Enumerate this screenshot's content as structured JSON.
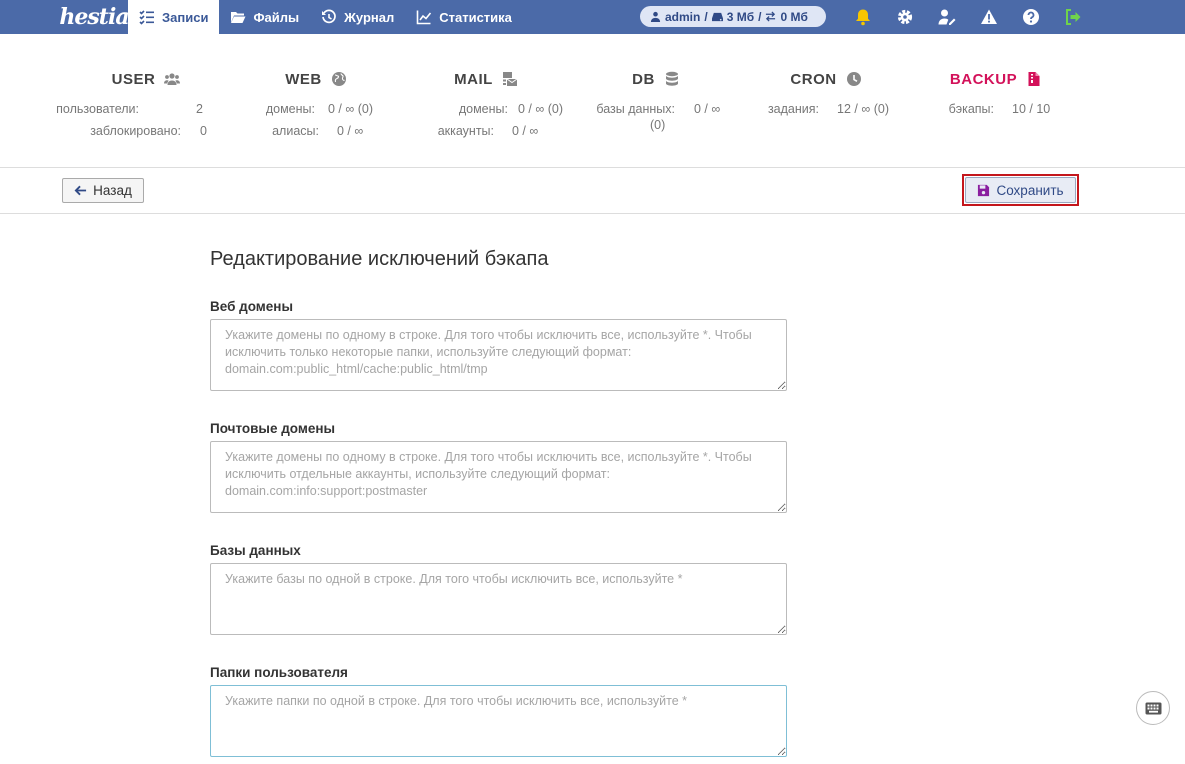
{
  "brand": {
    "logo_text": "hestia"
  },
  "nav": {
    "items": [
      {
        "label": "Записи",
        "icon": "list-check-icon",
        "active": true
      },
      {
        "label": "Файлы",
        "icon": "folder-open-icon"
      },
      {
        "label": "Журнал",
        "icon": "history-icon"
      },
      {
        "label": "Статистика",
        "icon": "chart-line-icon"
      }
    ]
  },
  "user_pill": {
    "user": "admin",
    "sep1": "/",
    "disk": "3 Мб",
    "sep2": "/",
    "traffic": "0 Мб"
  },
  "stats": [
    {
      "title": "USER",
      "icon": "users-icon",
      "rows": [
        {
          "label": "пользователи:",
          "value": "2"
        },
        {
          "label": "заблокировано:",
          "value": "0"
        }
      ]
    },
    {
      "title": "WEB",
      "icon": "globe-icon",
      "rows": [
        {
          "label": "домены:",
          "value": "0 / ∞ (0)"
        },
        {
          "label": "алиасы:",
          "value": "0 / ∞"
        }
      ]
    },
    {
      "title": "MAIL",
      "icon": "mail-bulk-icon",
      "rows": [
        {
          "label": "домены:",
          "value": "0 / ∞ (0)"
        },
        {
          "label": "аккаунты:",
          "value": "0 / ∞"
        }
      ]
    },
    {
      "title": "DB",
      "icon": "database-icon",
      "rows": [
        {
          "label": "базы данных:",
          "value": "0 / ∞",
          "extra": "(0)"
        }
      ]
    },
    {
      "title": "CRON",
      "icon": "clock-icon",
      "rows": [
        {
          "label": "задания:",
          "value": "12 / ∞ (0)"
        }
      ]
    },
    {
      "title": "BACKUP",
      "icon": "file-archive-icon",
      "accent": "#d3125a",
      "rows": [
        {
          "label": "бэкапы:",
          "value": "10 / 10"
        }
      ]
    }
  ],
  "toolbar": {
    "back_label": "Назад",
    "save_label": "Сохранить"
  },
  "form": {
    "title": "Редактирование исключений бэкапа",
    "fields": [
      {
        "label": "Веб домены",
        "value": "",
        "placeholder": "Укажите домены по одному в строке. Для того чтобы исключить все, используйте *. Чтобы исключить только некоторые папки, используйте следующий формат: domain.com:public_html/cache:public_html/tmp"
      },
      {
        "label": "Почтовые домены",
        "value": "",
        "placeholder": "Укажите домены по одному в строке. Для того чтобы исключить все, используйте *. Чтобы исключить отдельные аккаунты, используйте следующий формат: domain.com:info:support:postmaster"
      },
      {
        "label": "Базы данных",
        "value": "",
        "placeholder": "Укажите базы по одной в строке. Для того чтобы исключить все, используйте *"
      },
      {
        "label": "Папки пользователя",
        "value": "",
        "placeholder": "Укажите папки по одной в строке. Для того чтобы исключить все, используйте *"
      }
    ]
  },
  "colors": {
    "topbar": "#4b6aa8",
    "accent": "#d3125a",
    "highlight": "#c4161c",
    "bell": "#f7c600",
    "logout": "#6fd34b"
  }
}
